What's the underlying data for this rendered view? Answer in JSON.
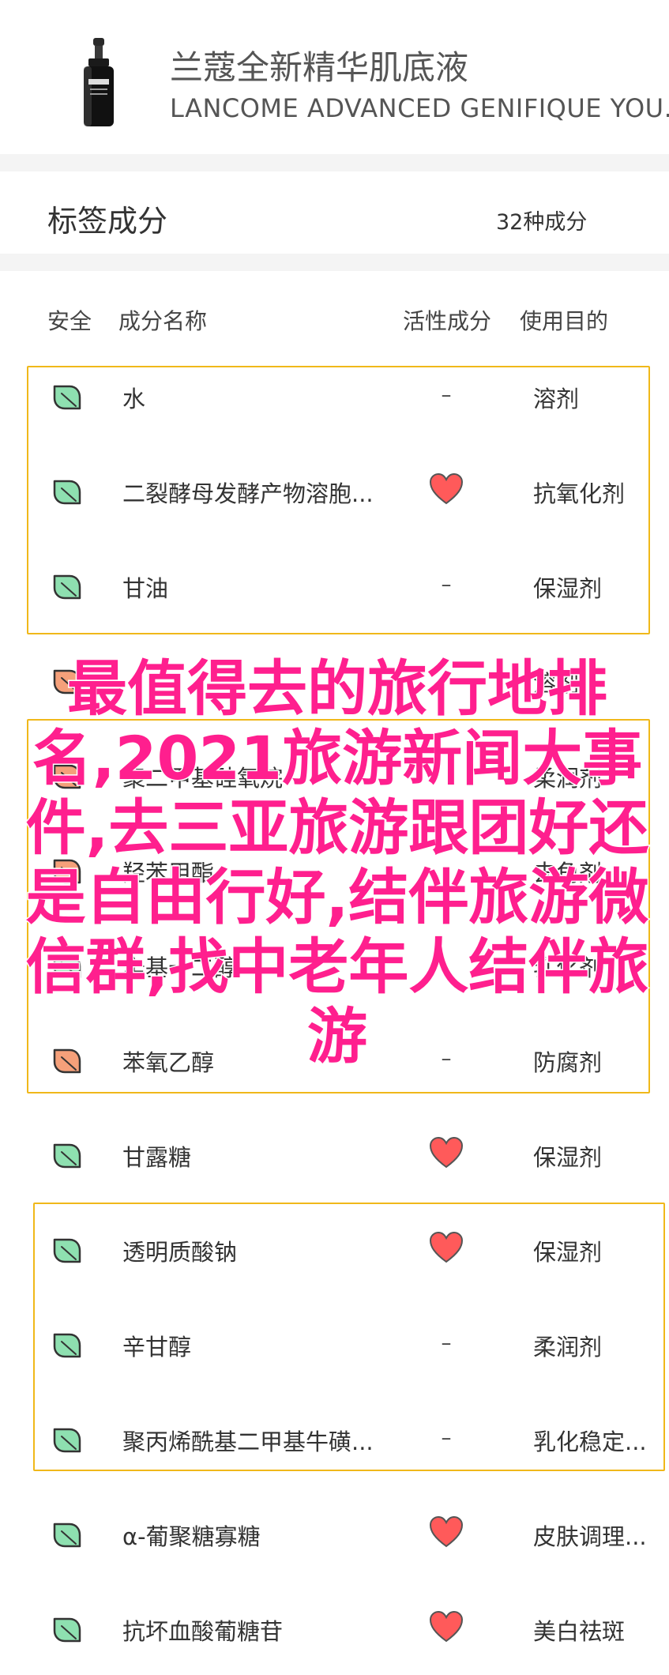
{
  "product": {
    "name_cn": "兰蔻全新精华肌底液",
    "name_en": "LANCOME ADVANCED GENIFIQUE YOU.",
    "bottle_label": "LANCOME"
  },
  "section": {
    "title": "标签成分",
    "count": "32种成分"
  },
  "columns": {
    "safety": "安全",
    "name": "成分名称",
    "active": "活性成分",
    "purpose": "使用目的"
  },
  "colors": {
    "safe": "#8ee0b0",
    "caution": "#f5a07a",
    "heart": "#ff5a5a",
    "box": "#f0b81a",
    "overlay": "#ff1f8e"
  },
  "ingredients": [
    {
      "name": "水",
      "safety": "safe",
      "active": "–",
      "purpose": "溶剂"
    },
    {
      "name": "二裂酵母发酵产物溶胞...",
      "safety": "safe",
      "active": "heart-icon",
      "purpose": "抗氧化剂"
    },
    {
      "name": "甘油",
      "safety": "safe",
      "active": "–",
      "purpose": "保湿剂"
    },
    {
      "name": "",
      "safety": "caution",
      "active": "",
      "purpose": "溶剂"
    },
    {
      "name": "聚二甲基硅氧烷",
      "safety": "caution",
      "active": "",
      "purpose": "柔润剂"
    },
    {
      "name": "羟苯甲酯",
      "safety": "caution",
      "active": "",
      "purpose": "去角剂"
    },
    {
      "name": "辛基十二醇",
      "safety": "safe",
      "active": "",
      "purpose": "乳化剂"
    },
    {
      "name": "苯氧乙醇",
      "safety": "caution",
      "active": "–",
      "purpose": "防腐剂"
    },
    {
      "name": "甘露糖",
      "safety": "safe",
      "active": "heart-icon",
      "purpose": "保湿剂"
    },
    {
      "name": "透明质酸钠",
      "safety": "safe",
      "active": "heart-icon",
      "purpose": "保湿剂"
    },
    {
      "name": "辛甘醇",
      "safety": "safe",
      "active": "–",
      "purpose": "柔润剂"
    },
    {
      "name": "聚丙烯酰基二甲基牛磺...",
      "safety": "safe",
      "active": "–",
      "purpose": "乳化稳定..."
    },
    {
      "name": "α-葡聚糖寡糖",
      "safety": "safe",
      "active": "heart-icon",
      "purpose": "皮肤调理..."
    },
    {
      "name": "抗坏血酸葡糖苷",
      "safety": "safe",
      "active": "heart-icon",
      "purpose": "美白祛斑"
    }
  ],
  "overlay_text": "最值得去的旅行地排名,2021旅游新闻大事件,去三亚旅游跟团好还是自由行好,结伴旅游微信群,找中老年人结伴旅游"
}
